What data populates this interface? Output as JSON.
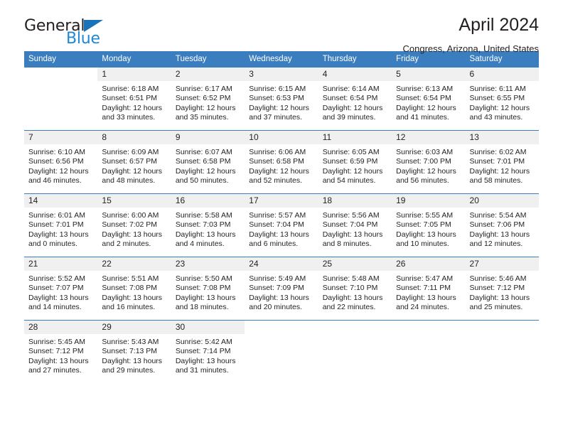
{
  "logo": {
    "text_primary": "General",
    "text_secondary": "Blue",
    "triangle_color": "#1a72b8",
    "secondary_color": "#1e87d6"
  },
  "header": {
    "title": "April 2024",
    "subtitle": "Congress, Arizona, United States"
  },
  "theme": {
    "header_bar_color": "#3a7ebf",
    "daynum_band_color": "#f0f0f0",
    "text_color": "#231f20"
  },
  "weekday_headers": [
    "Sunday",
    "Monday",
    "Tuesday",
    "Wednesday",
    "Thursday",
    "Friday",
    "Saturday"
  ],
  "weeks": [
    [
      {
        "day": "",
        "blank": true,
        "sunrise": "",
        "sunset": "",
        "daylight1": "",
        "daylight2": ""
      },
      {
        "day": "1",
        "sunrise": "Sunrise: 6:18 AM",
        "sunset": "Sunset: 6:51 PM",
        "daylight1": "Daylight: 12 hours",
        "daylight2": "and 33 minutes."
      },
      {
        "day": "2",
        "sunrise": "Sunrise: 6:17 AM",
        "sunset": "Sunset: 6:52 PM",
        "daylight1": "Daylight: 12 hours",
        "daylight2": "and 35 minutes."
      },
      {
        "day": "3",
        "sunrise": "Sunrise: 6:15 AM",
        "sunset": "Sunset: 6:53 PM",
        "daylight1": "Daylight: 12 hours",
        "daylight2": "and 37 minutes."
      },
      {
        "day": "4",
        "sunrise": "Sunrise: 6:14 AM",
        "sunset": "Sunset: 6:54 PM",
        "daylight1": "Daylight: 12 hours",
        "daylight2": "and 39 minutes."
      },
      {
        "day": "5",
        "sunrise": "Sunrise: 6:13 AM",
        "sunset": "Sunset: 6:54 PM",
        "daylight1": "Daylight: 12 hours",
        "daylight2": "and 41 minutes."
      },
      {
        "day": "6",
        "sunrise": "Sunrise: 6:11 AM",
        "sunset": "Sunset: 6:55 PM",
        "daylight1": "Daylight: 12 hours",
        "daylight2": "and 43 minutes."
      }
    ],
    [
      {
        "day": "7",
        "sunrise": "Sunrise: 6:10 AM",
        "sunset": "Sunset: 6:56 PM",
        "daylight1": "Daylight: 12 hours",
        "daylight2": "and 46 minutes."
      },
      {
        "day": "8",
        "sunrise": "Sunrise: 6:09 AM",
        "sunset": "Sunset: 6:57 PM",
        "daylight1": "Daylight: 12 hours",
        "daylight2": "and 48 minutes."
      },
      {
        "day": "9",
        "sunrise": "Sunrise: 6:07 AM",
        "sunset": "Sunset: 6:58 PM",
        "daylight1": "Daylight: 12 hours",
        "daylight2": "and 50 minutes."
      },
      {
        "day": "10",
        "sunrise": "Sunrise: 6:06 AM",
        "sunset": "Sunset: 6:58 PM",
        "daylight1": "Daylight: 12 hours",
        "daylight2": "and 52 minutes."
      },
      {
        "day": "11",
        "sunrise": "Sunrise: 6:05 AM",
        "sunset": "Sunset: 6:59 PM",
        "daylight1": "Daylight: 12 hours",
        "daylight2": "and 54 minutes."
      },
      {
        "day": "12",
        "sunrise": "Sunrise: 6:03 AM",
        "sunset": "Sunset: 7:00 PM",
        "daylight1": "Daylight: 12 hours",
        "daylight2": "and 56 minutes."
      },
      {
        "day": "13",
        "sunrise": "Sunrise: 6:02 AM",
        "sunset": "Sunset: 7:01 PM",
        "daylight1": "Daylight: 12 hours",
        "daylight2": "and 58 minutes."
      }
    ],
    [
      {
        "day": "14",
        "sunrise": "Sunrise: 6:01 AM",
        "sunset": "Sunset: 7:01 PM",
        "daylight1": "Daylight: 13 hours",
        "daylight2": "and 0 minutes."
      },
      {
        "day": "15",
        "sunrise": "Sunrise: 6:00 AM",
        "sunset": "Sunset: 7:02 PM",
        "daylight1": "Daylight: 13 hours",
        "daylight2": "and 2 minutes."
      },
      {
        "day": "16",
        "sunrise": "Sunrise: 5:58 AM",
        "sunset": "Sunset: 7:03 PM",
        "daylight1": "Daylight: 13 hours",
        "daylight2": "and 4 minutes."
      },
      {
        "day": "17",
        "sunrise": "Sunrise: 5:57 AM",
        "sunset": "Sunset: 7:04 PM",
        "daylight1": "Daylight: 13 hours",
        "daylight2": "and 6 minutes."
      },
      {
        "day": "18",
        "sunrise": "Sunrise: 5:56 AM",
        "sunset": "Sunset: 7:04 PM",
        "daylight1": "Daylight: 13 hours",
        "daylight2": "and 8 minutes."
      },
      {
        "day": "19",
        "sunrise": "Sunrise: 5:55 AM",
        "sunset": "Sunset: 7:05 PM",
        "daylight1": "Daylight: 13 hours",
        "daylight2": "and 10 minutes."
      },
      {
        "day": "20",
        "sunrise": "Sunrise: 5:54 AM",
        "sunset": "Sunset: 7:06 PM",
        "daylight1": "Daylight: 13 hours",
        "daylight2": "and 12 minutes."
      }
    ],
    [
      {
        "day": "21",
        "sunrise": "Sunrise: 5:52 AM",
        "sunset": "Sunset: 7:07 PM",
        "daylight1": "Daylight: 13 hours",
        "daylight2": "and 14 minutes."
      },
      {
        "day": "22",
        "sunrise": "Sunrise: 5:51 AM",
        "sunset": "Sunset: 7:08 PM",
        "daylight1": "Daylight: 13 hours",
        "daylight2": "and 16 minutes."
      },
      {
        "day": "23",
        "sunrise": "Sunrise: 5:50 AM",
        "sunset": "Sunset: 7:08 PM",
        "daylight1": "Daylight: 13 hours",
        "daylight2": "and 18 minutes."
      },
      {
        "day": "24",
        "sunrise": "Sunrise: 5:49 AM",
        "sunset": "Sunset: 7:09 PM",
        "daylight1": "Daylight: 13 hours",
        "daylight2": "and 20 minutes."
      },
      {
        "day": "25",
        "sunrise": "Sunrise: 5:48 AM",
        "sunset": "Sunset: 7:10 PM",
        "daylight1": "Daylight: 13 hours",
        "daylight2": "and 22 minutes."
      },
      {
        "day": "26",
        "sunrise": "Sunrise: 5:47 AM",
        "sunset": "Sunset: 7:11 PM",
        "daylight1": "Daylight: 13 hours",
        "daylight2": "and 24 minutes."
      },
      {
        "day": "27",
        "sunrise": "Sunrise: 5:46 AM",
        "sunset": "Sunset: 7:12 PM",
        "daylight1": "Daylight: 13 hours",
        "daylight2": "and 25 minutes."
      }
    ],
    [
      {
        "day": "28",
        "sunrise": "Sunrise: 5:45 AM",
        "sunset": "Sunset: 7:12 PM",
        "daylight1": "Daylight: 13 hours",
        "daylight2": "and 27 minutes."
      },
      {
        "day": "29",
        "sunrise": "Sunrise: 5:43 AM",
        "sunset": "Sunset: 7:13 PM",
        "daylight1": "Daylight: 13 hours",
        "daylight2": "and 29 minutes."
      },
      {
        "day": "30",
        "sunrise": "Sunrise: 5:42 AM",
        "sunset": "Sunset: 7:14 PM",
        "daylight1": "Daylight: 13 hours",
        "daylight2": "and 31 minutes."
      },
      {
        "day": "",
        "blank": true,
        "sunrise": "",
        "sunset": "",
        "daylight1": "",
        "daylight2": ""
      },
      {
        "day": "",
        "blank": true,
        "sunrise": "",
        "sunset": "",
        "daylight1": "",
        "daylight2": ""
      },
      {
        "day": "",
        "blank": true,
        "sunrise": "",
        "sunset": "",
        "daylight1": "",
        "daylight2": ""
      },
      {
        "day": "",
        "blank": true,
        "sunrise": "",
        "sunset": "",
        "daylight1": "",
        "daylight2": ""
      }
    ]
  ]
}
